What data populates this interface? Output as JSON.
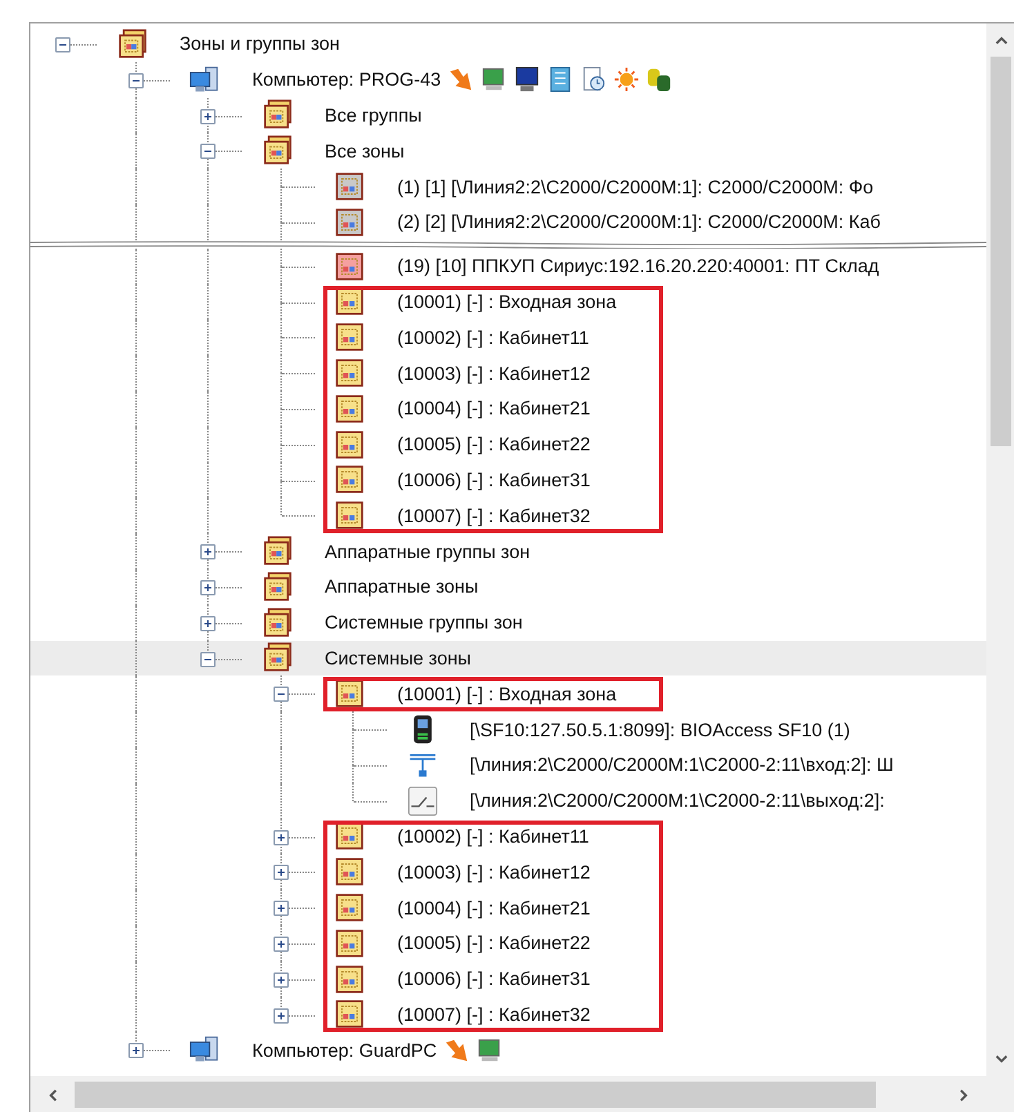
{
  "tree": [
    {
      "label": "Зоны и группы зон",
      "kind": "group",
      "expanded": true,
      "selected": false,
      "children": [
        {
          "label": "Компьютер: PROG-43",
          "kind": "computer",
          "expanded": true,
          "selected": false,
          "status_icons": [
            {
              "kind": "arrow"
            },
            {
              "kind": "monitor"
            },
            {
              "kind": "screen"
            },
            {
              "kind": "notebook"
            },
            {
              "kind": "clock"
            },
            {
              "kind": "sun"
            },
            {
              "kind": "cylinders"
            }
          ],
          "children": [
            {
              "label": "Все группы",
              "kind": "group",
              "expanded": false,
              "selected": false
            },
            {
              "label": "Все зоны",
              "kind": "group",
              "expanded": true,
              "selected": false,
              "children": [
                {
                  "label": "(1) [1] [\\Линия2:2\\C2000/C2000M:1]: C2000/C2000M: Фо",
                  "kind": "zone",
                  "color": "#c9c9c9",
                  "selected": false,
                  "highlighted": false
                },
                {
                  "label": "(2) [2] [\\Линия2:2\\C2000/C2000M:1]: C2000/C2000M: Каб",
                  "kind": "zone",
                  "color": "#c9c9c9",
                  "selected": false,
                  "highlighted": false,
                  "cut_below": true
                },
                {
                  "label": "(19) [10] ППКУП Сириус:192.16.20.220:40001: ПТ Склад",
                  "kind": "zone",
                  "color": "#f5a0a0",
                  "selected": false,
                  "highlighted": false
                },
                {
                  "label": "(10001) [-] : Входная зона",
                  "kind": "zone",
                  "color": "#f7e08a",
                  "selected": false,
                  "highlighted": true
                },
                {
                  "label": "(10002) [-] : Кабинет11",
                  "kind": "zone",
                  "color": "#f7e08a",
                  "selected": false,
                  "highlighted": true
                },
                {
                  "label": "(10003) [-] : Кабинет12",
                  "kind": "zone",
                  "color": "#f7e08a",
                  "selected": false,
                  "highlighted": true
                },
                {
                  "label": "(10004) [-] : Кабинет21",
                  "kind": "zone",
                  "color": "#f7e08a",
                  "selected": false,
                  "highlighted": true
                },
                {
                  "label": "(10005) [-] : Кабинет22",
                  "kind": "zone",
                  "color": "#f7e08a",
                  "selected": false,
                  "highlighted": true
                },
                {
                  "label": "(10006) [-] : Кабинет31",
                  "kind": "zone",
                  "color": "#f7e08a",
                  "selected": false,
                  "highlighted": true
                },
                {
                  "label": "(10007) [-] : Кабинет32",
                  "kind": "zone",
                  "color": "#f7e08a",
                  "selected": false,
                  "highlighted": true
                }
              ]
            },
            {
              "label": "Аппаратные группы зон",
              "kind": "group",
              "expanded": false,
              "selected": false
            },
            {
              "label": "Аппаратные зоны",
              "kind": "group",
              "expanded": false,
              "selected": false
            },
            {
              "label": "Системные группы зон",
              "kind": "group",
              "expanded": false,
              "selected": false
            },
            {
              "label": "Системные зоны",
              "kind": "group",
              "expanded": true,
              "selected": true,
              "children": [
                {
                  "label": "(10001) [-] : Входная зона",
                  "kind": "zone",
                  "color": "#f7e08a",
                  "expanded": true,
                  "selected": false,
                  "highlighted": true,
                  "children": [
                    {
                      "label": "[\\SF10:127.50.5.1:8099]: BIOAccess SF10 (1)",
                      "kind": "reader",
                      "selected": false
                    },
                    {
                      "label": "[\\линия:2\\C2000/C2000M:1\\C2000-2:11\\вход:2]: Ш",
                      "kind": "input",
                      "selected": false
                    },
                    {
                      "label": "[\\линия:2\\C2000/C2000M:1\\C2000-2:11\\выход:2]:",
                      "kind": "relay",
                      "selected": false
                    }
                  ]
                },
                {
                  "label": "(10002) [-] : Кабинет11",
                  "kind": "zone",
                  "color": "#f7e08a",
                  "expanded": false,
                  "selected": false,
                  "highlighted": true
                },
                {
                  "label": "(10003) [-] : Кабинет12",
                  "kind": "zone",
                  "color": "#f7e08a",
                  "expanded": false,
                  "selected": false,
                  "highlighted": true
                },
                {
                  "label": "(10004) [-] : Кабинет21",
                  "kind": "zone",
                  "color": "#f7e08a",
                  "expanded": false,
                  "selected": false,
                  "highlighted": true
                },
                {
                  "label": "(10005) [-] : Кабинет22",
                  "kind": "zone",
                  "color": "#f7e08a",
                  "expanded": false,
                  "selected": false,
                  "highlighted": true
                },
                {
                  "label": "(10006) [-] : Кабинет31",
                  "kind": "zone",
                  "color": "#f7e08a",
                  "expanded": false,
                  "selected": false,
                  "highlighted": true
                },
                {
                  "label": "(10007) [-] : Кабинет32",
                  "kind": "zone",
                  "color": "#f7e08a",
                  "expanded": false,
                  "selected": false,
                  "highlighted": true
                }
              ]
            }
          ]
        },
        {
          "label": "Компьютер: GuardPC",
          "kind": "computer",
          "expanded": false,
          "selected": false,
          "status_icons": [
            {
              "kind": "arrow"
            },
            {
              "kind": "monitor"
            }
          ]
        }
      ]
    }
  ]
}
